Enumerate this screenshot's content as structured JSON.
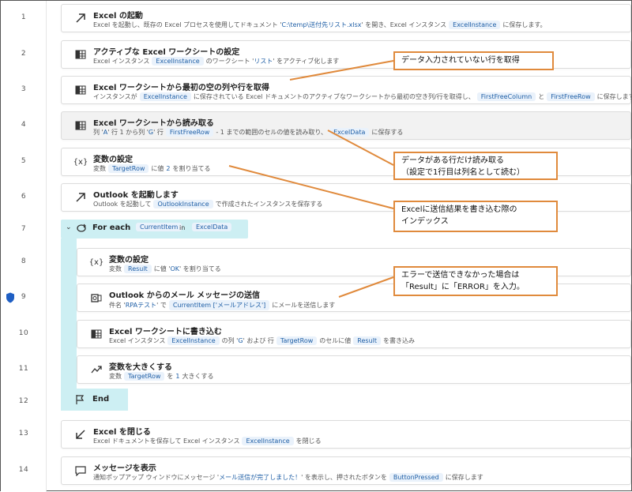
{
  "line_numbers": [
    "1",
    "2",
    "3",
    "4",
    "5",
    "6",
    "7",
    "8",
    "9",
    "10",
    "11",
    "12",
    "13",
    "14"
  ],
  "steps": [
    {
      "title": "Excel の起動",
      "desc_a": "Excel を起動し、既存の Excel プロセスを使用してドキュメント '",
      "desc_lit": "C:\\temp\\送付先リスト.xlsx",
      "desc_b": "' を開き、Excel インスタンス",
      "tok1": "ExcelInstance",
      "desc_c": "に保存します。"
    },
    {
      "title": "アクティブな Excel ワークシートの設定",
      "desc_a": "Excel インスタンス",
      "tok1": "ExcelInstance",
      "desc_b": "のワークシート '",
      "desc_lit": "リスト",
      "desc_c": "' をアクティブ化します"
    },
    {
      "title": "Excel ワークシートから最初の空の列や行を取得",
      "desc_a": "インスタンスが",
      "tok1": "ExcelInstance",
      "desc_b": "に保存されている Excel ドキュメントのアクティブなワークシートから最初の空き列/行を取得し、",
      "tok2": "FirstFreeColumn",
      "desc_c": "と",
      "tok3": "FirstFreeRow",
      "desc_d": "に保存します"
    },
    {
      "title": "Excel ワークシートから読み取る",
      "desc_a": "列 '",
      "lit1": "A",
      "desc_b": "' 行 1 から列 '",
      "lit2": "G",
      "desc_c": "' 行",
      "tok1": "FirstFreeRow",
      "desc_d": "- 1 までの範囲のセルの値を読み取り、",
      "tok2": "ExcelData",
      "desc_e": "に保存する"
    },
    {
      "title": "変数の設定",
      "desc_a": "変数",
      "tok1": "TargetRow",
      "desc_b": "に値",
      "lit1": "2",
      "desc_c": "を割り当てる"
    },
    {
      "title": "Outlook を起動します",
      "desc_a": "Outlook を起動して",
      "tok1": "OutlookInstance",
      "desc_b": "で作成されたインスタンスを保存する"
    },
    {
      "title": "変数の設定",
      "desc_a": "変数",
      "tok1": "Result",
      "desc_b": "に値 '",
      "lit1": "OK",
      "desc_c": "' を割り当てる"
    },
    {
      "title": "Outlook からのメール メッセージの送信",
      "desc_a": "件名 '",
      "lit1": "RPAテスト",
      "desc_b": "' で",
      "tok1": "CurrentItem",
      "tok1b": "['メールアドレス']",
      "desc_c": "にメールを送信します"
    },
    {
      "title": "Excel ワークシートに書き込む",
      "desc_a": "Excel インスタンス",
      "tok1": "ExcelInstance",
      "desc_b": "の列 '",
      "lit1": "G",
      "desc_c": "' および 行",
      "tok2": "TargetRow",
      "desc_d": "のセルに値",
      "tok3": "Result",
      "desc_e": "を書き込み"
    },
    {
      "title": "変数を大きくする",
      "desc_a": "変数",
      "tok1": "TargetRow",
      "desc_b": "を",
      "lit1": "1",
      "desc_c": "大きくする"
    },
    {
      "title": "Excel を閉じる",
      "desc_a": "Excel ドキュメントを保存して Excel インスタンス",
      "tok1": "ExcelInstance",
      "desc_b": "を閉じる"
    },
    {
      "title": "メッセージを表示",
      "desc_a": "通知ポップアップ ウィンドウにメッセージ '",
      "lit1": "メール送信が完了しました！",
      "desc_b": "' を表示し、押されたボタンを",
      "tok1": "ButtonPressed",
      "desc_c": "に保存します"
    }
  ],
  "foreach": {
    "keyword": "For each",
    "var": "CurrentItem",
    "in": "in",
    "collection": "ExcelData"
  },
  "end_label": "End",
  "callouts": {
    "c1": "データ入力されていない行を取得",
    "c2_line1": "データがある行だけ読み取る",
    "c2_line2": "（設定で1行目は列名として読む）",
    "c3_line1": "Excelに送信結果を書き込む際の",
    "c3_line2": "インデックス",
    "c4_line1": "エラーで送信できなかった場合は",
    "c4_line2": "「Result」に「ERROR」を入力。"
  },
  "colors": {
    "accent_loop": "#cdeff3",
    "callout_border": "#e08a3c",
    "token_bg": "#eaf2fb",
    "token_text": "#1f5fa6",
    "shield": "#1f5fc4"
  }
}
